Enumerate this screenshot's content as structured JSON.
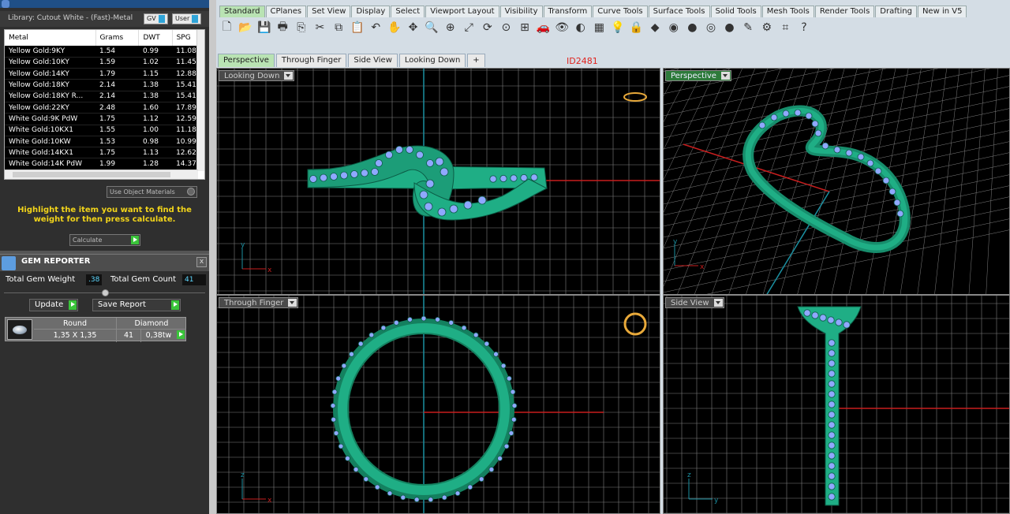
{
  "library": {
    "title": "Library: Cutout White - (Fast)-Metal",
    "gv_label": "GV",
    "user_label": "User"
  },
  "metal_table": {
    "headers": [
      "Metal",
      "Grams",
      "DWT",
      "SPG"
    ],
    "rows": [
      [
        "Yellow Gold:9KY",
        "1.54",
        "0.99",
        "11.08"
      ],
      [
        "Yellow Gold:10KY",
        "1.59",
        "1.02",
        "11.45"
      ],
      [
        "Yellow Gold:14KY",
        "1.79",
        "1.15",
        "12.88"
      ],
      [
        "Yellow Gold:18KY",
        "2.14",
        "1.38",
        "15.41"
      ],
      [
        "Yellow Gold:18KY R...",
        "2.14",
        "1.38",
        "15.41"
      ],
      [
        "Yellow Gold:22KY",
        "2.48",
        "1.60",
        "17.89"
      ],
      [
        "White Gold:9K PdW",
        "1.75",
        "1.12",
        "12.59"
      ],
      [
        "White Gold:10KX1",
        "1.55",
        "1.00",
        "11.18"
      ],
      [
        "White Gold:10KW",
        "1.53",
        "0.98",
        "10.99"
      ],
      [
        "White Gold:14KX1",
        "1.75",
        "1.13",
        "12.62"
      ],
      [
        "White Gold:14K PdW",
        "1.99",
        "1.28",
        "14.37"
      ]
    ]
  },
  "use_object_materials": "Use Object Materials",
  "highlight_message": "Highlight the item you want to find the weight for then press calculate.",
  "calculate_label": "Calculate",
  "gem_reporter": {
    "title": "GEM REPORTER",
    "close": "x",
    "total_weight_label": "Total Gem Weight",
    "total_weight_value": ".38",
    "total_count_label": "Total Gem Count",
    "total_count_value": "41",
    "update_label": "Update",
    "save_report_label": "Save Report",
    "gem": {
      "shape": "Round",
      "type": "Diamond",
      "size": "1,35 X 1,35",
      "count": "41",
      "weight": "0,38tw"
    }
  },
  "toolbar_tabs": [
    "Standard",
    "CPlanes",
    "Set View",
    "Display",
    "Select",
    "Viewport Layout",
    "Visibility",
    "Transform",
    "Curve Tools",
    "Surface Tools",
    "Solid Tools",
    "Mesh Tools",
    "Render Tools",
    "Drafting",
    "New in V5"
  ],
  "toolbar_icons": [
    "new-file-icon",
    "open-icon",
    "save-icon",
    "print-icon",
    "import-icon",
    "cut-icon",
    "copy-icon",
    "paste-icon",
    "undo-icon",
    "pan-icon",
    "move-icon",
    "zoom-icon",
    "zoom-window-icon",
    "zoom-extents-icon",
    "rotate-view-icon",
    "zoom-selected-icon",
    "four-view-icon",
    "car-icon",
    "hide-icon",
    "show-icon",
    "layers-icon",
    "light-icon",
    "lock-icon",
    "material-icon",
    "color-wheel-icon",
    "sphere-shaded-icon",
    "sphere-render-icon",
    "sphere-blue-icon",
    "properties-icon",
    "settings-icon",
    "snap-icon",
    "help-icon"
  ],
  "toolbar_glyphs": [
    "🗋",
    "📂",
    "💾",
    "🖶",
    "⎘",
    "✂",
    "⧉",
    "📋",
    "↶",
    "✋",
    "✥",
    "🔍",
    "⊕",
    "⤢",
    "⟳",
    "⊙",
    "⊞",
    "🚗",
    "👁",
    "◐",
    "▦",
    "💡",
    "🔒",
    "◆",
    "◉",
    "●",
    "◎",
    "●",
    "✎",
    "⚙",
    "⌗",
    "?"
  ],
  "viewport_tabs": [
    "Perspective",
    "Through Finger",
    "Side View",
    "Looking Down",
    "+"
  ],
  "id_label": "ID2481",
  "viewports": {
    "looking_down": "Looking Down",
    "perspective": "Perspective",
    "through_finger": "Through Finger",
    "side_view": "Side View"
  },
  "axis_labels": {
    "x": "x",
    "y": "y",
    "z": "z"
  },
  "colors": {
    "ring_green": "#1fae85",
    "gem_blue": "#8fa8ff",
    "grid": "#7f7f7f",
    "x_axis": "#c81e1e",
    "y_axis": "#1b8fa0",
    "accent_tab": "#b9e3b3",
    "highlight_text": "#f2d41a"
  }
}
